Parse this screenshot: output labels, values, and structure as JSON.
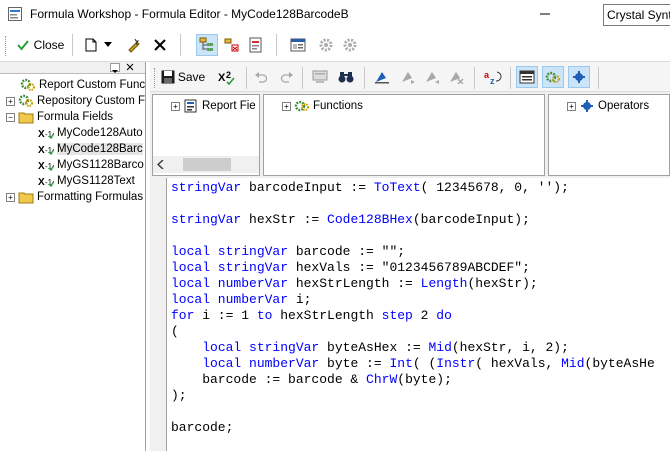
{
  "window": {
    "title": "Formula Workshop - Formula Editor - MyCode128BarcodeB"
  },
  "toolbar": {
    "close_label": "Close"
  },
  "tree": {
    "items": [
      {
        "label": "Report Custom Func"
      },
      {
        "label": "Repository Custom F"
      },
      {
        "label": "Formula Fields"
      },
      {
        "label": "MyCode128Auto"
      },
      {
        "label": "MyCode128Barc"
      },
      {
        "label": "MyGS1128Barco"
      },
      {
        "label": "MyGS1128Text"
      },
      {
        "label": "Formatting Formulas"
      }
    ]
  },
  "editor_toolbar": {
    "save_label": "Save",
    "syntax_value": "Crystal Syntax"
  },
  "panes": {
    "report_fields": "Report Fie",
    "functions": "Functions",
    "operators": "Operators"
  },
  "code": {
    "lines": [
      [
        {
          "t": "stringVar",
          "kw": true
        },
        {
          "t": " barcodeInput := ",
          "kw": false
        },
        {
          "t": "ToText",
          "kw": true
        },
        {
          "t": "( 12345678, 0, '');",
          "kw": false
        }
      ],
      [],
      [
        {
          "t": "stringVar",
          "kw": true
        },
        {
          "t": " hexStr := ",
          "kw": false
        },
        {
          "t": "Code128BHex",
          "kw": true
        },
        {
          "t": "(barcodeInput);",
          "kw": false
        }
      ],
      [],
      [
        {
          "t": "local stringVar",
          "kw": true
        },
        {
          "t": " barcode := \"\";",
          "kw": false
        }
      ],
      [
        {
          "t": "local stringVar",
          "kw": true
        },
        {
          "t": " hexVals := \"0123456789ABCDEF\";",
          "kw": false
        }
      ],
      [
        {
          "t": "local numberVar",
          "kw": true
        },
        {
          "t": " hexStrLength := ",
          "kw": false
        },
        {
          "t": "Length",
          "kw": true
        },
        {
          "t": "(hexStr);",
          "kw": false
        }
      ],
      [
        {
          "t": "local numberVar",
          "kw": true
        },
        {
          "t": " i;",
          "kw": false
        }
      ],
      [
        {
          "t": "for",
          "kw": true
        },
        {
          "t": " i := 1 ",
          "kw": false
        },
        {
          "t": "to",
          "kw": true
        },
        {
          "t": " hexStrLength ",
          "kw": false
        },
        {
          "t": "step",
          "kw": true
        },
        {
          "t": " 2 ",
          "kw": false
        },
        {
          "t": "do",
          "kw": true
        }
      ],
      [
        {
          "t": "(",
          "kw": false
        }
      ],
      [
        {
          "t": "    ",
          "kw": false
        },
        {
          "t": "local stringVar",
          "kw": true
        },
        {
          "t": " byteAsHex := ",
          "kw": false
        },
        {
          "t": "Mid",
          "kw": true
        },
        {
          "t": "(hexStr, i, 2);",
          "kw": false
        }
      ],
      [
        {
          "t": "    ",
          "kw": false
        },
        {
          "t": "local numberVar",
          "kw": true
        },
        {
          "t": " byte := ",
          "kw": false
        },
        {
          "t": "Int",
          "kw": true
        },
        {
          "t": "( (",
          "kw": false
        },
        {
          "t": "Instr",
          "kw": true
        },
        {
          "t": "( hexVals, ",
          "kw": false
        },
        {
          "t": "Mid",
          "kw": true
        },
        {
          "t": "(byteAsHe",
          "kw": false
        }
      ],
      [
        {
          "t": "    barcode := barcode & ",
          "kw": false
        },
        {
          "t": "ChrW",
          "kw": true
        },
        {
          "t": "(byte);",
          "kw": false
        }
      ],
      [
        {
          "t": ");",
          "kw": false
        }
      ],
      [],
      [
        {
          "t": "barcode;",
          "kw": false
        }
      ]
    ]
  },
  "colors": {
    "keyword": "#0000ff",
    "text": "#000000"
  }
}
